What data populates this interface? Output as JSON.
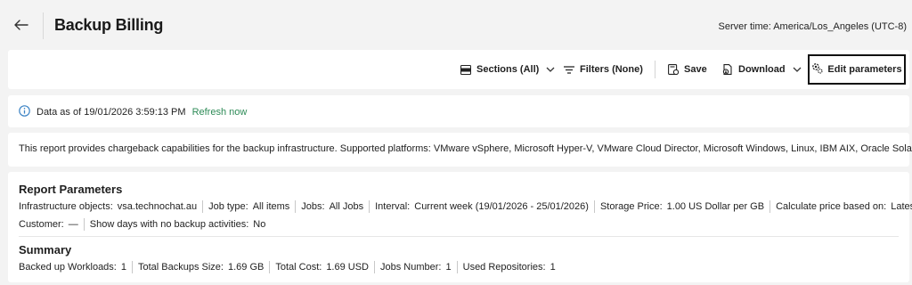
{
  "header": {
    "title": "Backup Billing",
    "server_time": "Server time: America/Los_Angeles (UTC-8)"
  },
  "toolbar": {
    "sections_label": "Sections (All)",
    "filters_label": "Filters (None)",
    "save_label": "Save",
    "download_label": "Download",
    "edit_params_label": "Edit parameters"
  },
  "info": {
    "data_as_of": "Data as of 19/01/2026 3:59:13 PM",
    "refresh_label": "Refresh now"
  },
  "description": "This report provides chargeback capabilities for the backup infrastructure. Supported platforms: VMware vSphere, Microsoft Hyper-V, VMware Cloud Director, Microsoft Windows, Linux, IBM AIX, Oracle Solaris, Mac.",
  "report_parameters": {
    "title": "Report Parameters",
    "row1": [
      {
        "key": "Infrastructure objects:",
        "value": "vsa.technochat.au"
      },
      {
        "key": "Job type:",
        "value": "All items"
      },
      {
        "key": "Jobs:",
        "value": "All Jobs"
      },
      {
        "key": "Interval:",
        "value": "Current week (19/01/2026 - 25/01/2026)"
      },
      {
        "key": "Storage Price:",
        "value": "1.00 US Dollar per GB"
      },
      {
        "key": "Calculate price based on:",
        "value": "Latest value"
      }
    ],
    "row2": [
      {
        "key": "Customer:",
        "value": "—"
      },
      {
        "key": "Show days with no backup activities:",
        "value": "No"
      }
    ]
  },
  "summary": {
    "title": "Summary",
    "items": [
      {
        "key": "Backed up Workloads:",
        "value": "1"
      },
      {
        "key": "Total Backups Size:",
        "value": "1.69 GB"
      },
      {
        "key": "Total Cost:",
        "value": "1.69 USD"
      },
      {
        "key": "Jobs Number:",
        "value": "1"
      },
      {
        "key": "Used Repositories:",
        "value": "1"
      }
    ]
  },
  "colors": {
    "refresh_link": "#2e8b57",
    "info_icon": "#3b82c4",
    "background": "#f3f3f3",
    "card": "#ffffff"
  }
}
